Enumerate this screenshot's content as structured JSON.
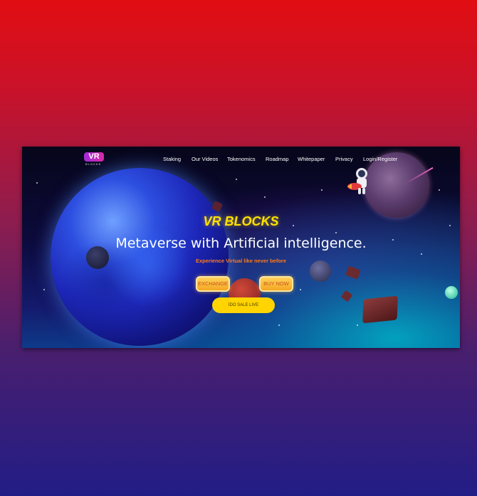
{
  "brand": {
    "logo_text": "VR",
    "logo_sub": "BLOCKS"
  },
  "nav": {
    "items": [
      "Staking",
      "Our Videos",
      "Tokenomics",
      "Roadmap",
      "Whitepaper",
      "Privacy",
      "Login/Register"
    ]
  },
  "hero": {
    "title": "VR BLOCKS",
    "headline": "Metaverse with Artificial intelligence.",
    "tagline": "Experience Virtual like never before"
  },
  "buttons": {
    "exchange": "EXCHANGE",
    "buy_now": "BUY NOW",
    "ido": "IDO SALE LIVE"
  },
  "colors": {
    "accent_yellow": "#ffe100",
    "tagline_orange": "#ff7a1a",
    "logo_purple": "#a02bd8"
  }
}
